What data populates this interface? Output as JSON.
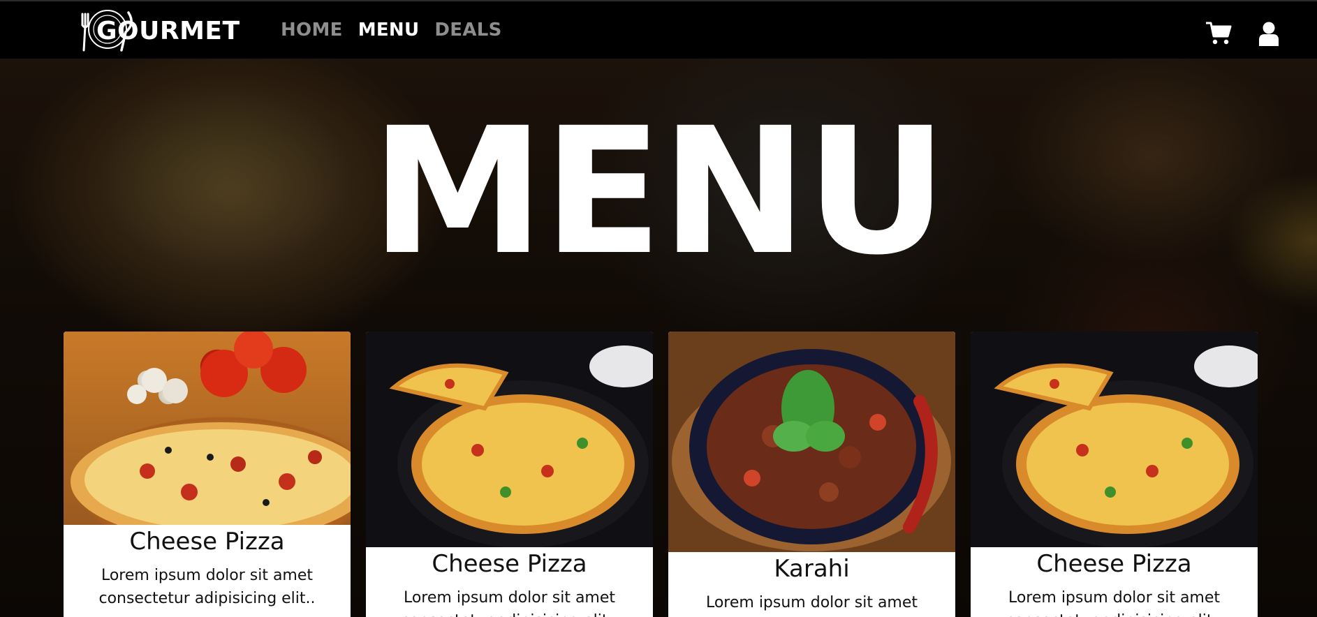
{
  "brand": {
    "name": "GOURMET"
  },
  "nav": {
    "links": [
      {
        "label": "HOME",
        "active": false
      },
      {
        "label": "MENU",
        "active": true
      },
      {
        "label": "DEALS",
        "active": false
      }
    ],
    "icons": [
      "cart-icon",
      "user-icon"
    ]
  },
  "hero": {
    "title": "MENU"
  },
  "cards": [
    {
      "title": "Cheese Pizza",
      "description": "Lorem ipsum dolor sit amet consectetur adipisicing elit..",
      "image": "pizza-photo"
    },
    {
      "title": "Cheese Pizza",
      "description": "Lorem ipsum dolor sit amet consectetur adipisicing elit..",
      "image": "pizza-slice-photo"
    },
    {
      "title": "Karahi",
      "description": "Lorem ipsum dolor sit amet",
      "image": "karahi-photo"
    },
    {
      "title": "Cheese Pizza",
      "description": "Lorem ipsum dolor sit amet consectetur adipisicing elit..",
      "image": "pizza-slice-photo"
    }
  ],
  "colors": {
    "navbar_bg": "#000000",
    "nav_active": "#ffffff",
    "nav_inactive": "#8e8e8e",
    "card_bg": "#ffffff"
  }
}
